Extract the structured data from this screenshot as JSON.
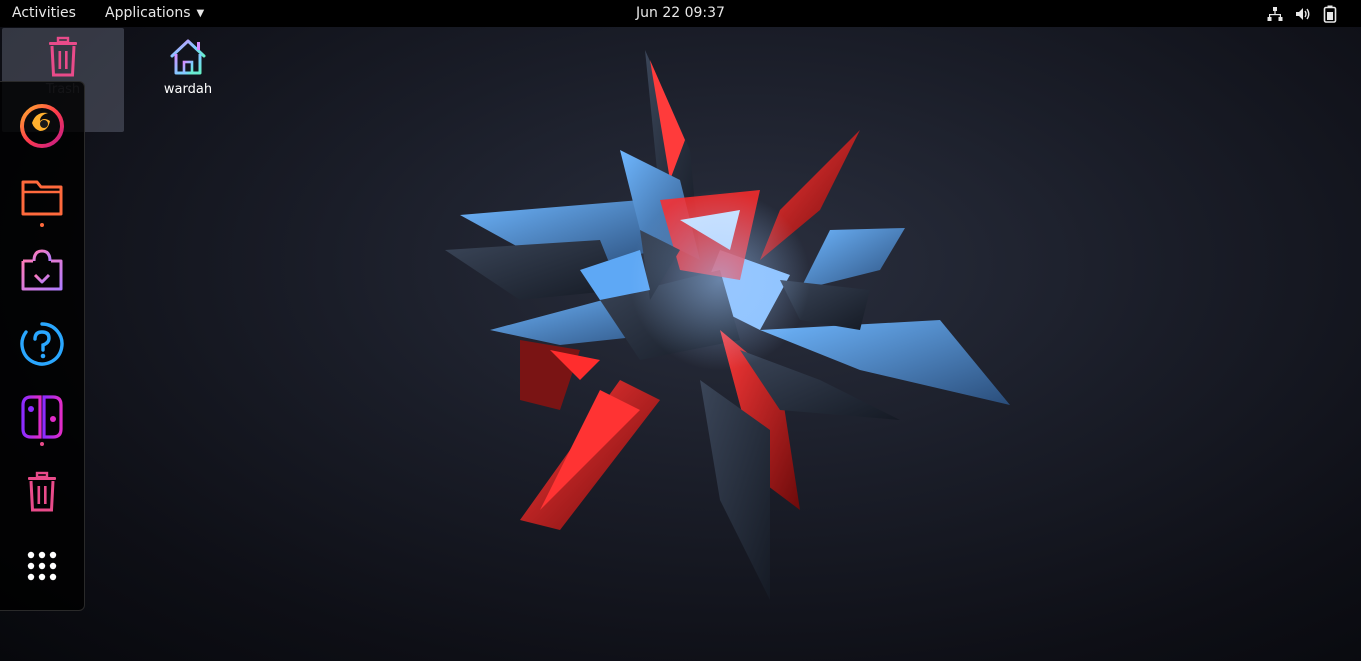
{
  "topbar": {
    "activities": "Activities",
    "applications": "Applications",
    "clock": "Jun 22  09:37",
    "tray": [
      "network-icon",
      "volume-icon",
      "battery-icon"
    ]
  },
  "desktop": {
    "icons": [
      {
        "label": "Trash",
        "icon": "trash-icon"
      },
      {
        "label": "wardah",
        "icon": "home-folder-icon"
      }
    ]
  },
  "dock": {
    "items": [
      {
        "icon": "firefox-icon"
      },
      {
        "icon": "files-icon"
      },
      {
        "icon": "software-installer-icon"
      },
      {
        "icon": "help-icon"
      },
      {
        "icon": "nintendo-switch-icon"
      },
      {
        "icon": "trash-icon"
      },
      {
        "icon": "show-applications-icon"
      }
    ]
  },
  "colors": {
    "topbar_bg": "#000000",
    "dock_bg": "#000000",
    "accent_pink": "#e94b8a",
    "accent_orange": "#ff6a3d",
    "accent_purple": "#9b4bd8",
    "accent_blue": "#2aa7ff"
  }
}
